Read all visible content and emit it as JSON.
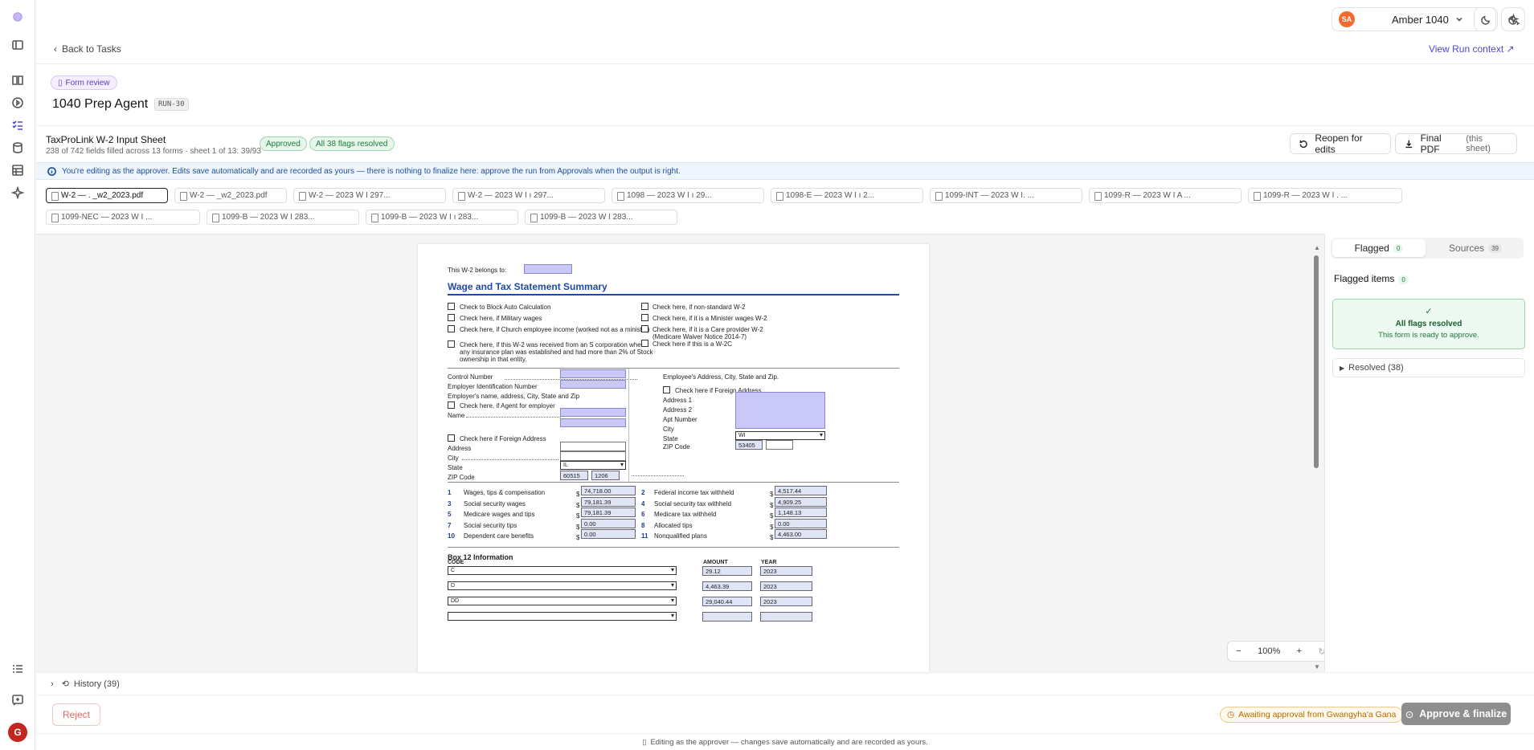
{
  "colors": {
    "accent": "#4b49c9",
    "approved": "#1c7a3c",
    "warning": "#b36b00",
    "reject": "#e06666",
    "avatar": "#f26a2e",
    "rail_user": "#c2261c"
  },
  "rail_icons": [
    "sidebar-toggle-icon",
    "book-icon",
    "play-icon",
    "tasks-icon",
    "database-icon",
    "table-icon",
    "sparkles-icon",
    "list-icon",
    "feedback-icon"
  ],
  "user": {
    "initials": "SA",
    "name": "Amber 1040",
    "rail_initial": "G"
  },
  "nav": {
    "back": "Back to Tasks",
    "run_context": "View Run context ↗"
  },
  "header": {
    "badge": "Form review",
    "title": "1040 Prep Agent",
    "run": "RUN-30"
  },
  "sheet": {
    "title": "TaxProLink W-2 Input Sheet",
    "subtitle": "238 of 742 fields filled across 13 forms · sheet 1 of 13: 39/93",
    "status": "Approved",
    "flags": "All 38 flags resolved",
    "reopen": "Reopen for edits",
    "final_pdf": "Final PDF",
    "final_pdf_note": "(this sheet)"
  },
  "info": "You're editing as the approver. Edits save automatically and are recorded as yours — there is nothing to finalize here: approve the run from Approvals when the output is right.",
  "tabs": [
    {
      "label": "W-2 — .        _w2_2023.pdf"
    },
    {
      "label": "W-2 —            _w2_2023.pdf"
    },
    {
      "label": "W-2 — 2023 W I                       297..."
    },
    {
      "label": "W-2 — 2023 W I                   ı 297..."
    },
    {
      "label": "1098 — 2023 W I                  ı 29..."
    },
    {
      "label": "1098-E — 2023 W I                  ı 2..."
    },
    {
      "label": "1099-INT — 2023 W I.                  ..."
    },
    {
      "label": "1099-R — 2023 W I A                  ..."
    },
    {
      "label": "1099-R — 2023 W I .                  ..."
    },
    {
      "label": "1099-NEC — 2023 W I                  ..."
    },
    {
      "label": "1099-B — 2023 W I                   283..."
    },
    {
      "label": "1099-B — 2023 W I              ı 283..."
    },
    {
      "label": "1099-B — 2023 W I                   283..."
    }
  ],
  "form": {
    "belongs": "This W-2 belongs to:",
    "heading": "Wage and Tax Statement Summary",
    "checks_left": [
      "Check to Block Auto Calculation",
      "Check here, if Military wages",
      "Check here, if Church employee income (worked not as a minister)",
      "Check here, if this W-2 was received from an S corporation where",
      "any insurance plan was established and had more than 2% of Stock",
      "ownership in that entity."
    ],
    "checks_right": [
      "Check here, if non-standard W-2",
      "Check here, if it is a Minister wages W-2",
      "Check here, if it is a Care provider W-2",
      "(Medicare Waiver Notice 2014-7)",
      "Check here if this is a W-2C"
    ],
    "employer": {
      "control": "Control Number",
      "ein": "Employer Identification Number",
      "name_addr": "Employer's name, address, City, State and Zip",
      "agent": "Check here, if Agent for employer",
      "name": "Name",
      "foreign": "Check here if Foreign Address",
      "address": "Address",
      "city": "City",
      "state": "State",
      "zip": "ZIP Code",
      "state_value": "IL",
      "zip1": "60515",
      "zip2": "1206"
    },
    "employee": {
      "heading": "Employee's Address, City, State and Zip.",
      "foreign": "Check here if Foreign Address",
      "address1": "Address 1",
      "address2": "Address 2",
      "apt": "Apt Number",
      "city": "City",
      "state": "State",
      "zip": "ZIP Code",
      "state_value": "WI",
      "zip1": "53405"
    },
    "boxes_left": [
      {
        "num": "1",
        "label": "Wages, tips & compensation",
        "value": "74,718.00"
      },
      {
        "num": "3",
        "label": "Social security wages",
        "value": "79,181.39"
      },
      {
        "num": "5",
        "label": "Medicare wages and tips",
        "value": "79,181.39"
      },
      {
        "num": "7",
        "label": "Social security tips",
        "value": "0.00"
      },
      {
        "num": "10",
        "label": "Dependent care benefits",
        "value": "0.00"
      }
    ],
    "boxes_right": [
      {
        "num": "2",
        "label": "Federal income tax withheld",
        "value": "4,517.44"
      },
      {
        "num": "4",
        "label": "Social security tax withheld",
        "value": "4,909.25"
      },
      {
        "num": "6",
        "label": "Medicare tax withheld",
        "value": "1,148.13"
      },
      {
        "num": "8",
        "label": "Allocated tips",
        "value": "0.00"
      },
      {
        "num": "11",
        "label": "Nonqualified plans",
        "value": "4,463.00"
      }
    ],
    "dollar": "$",
    "box12": {
      "heading": "Box 12 Information",
      "code": "CODE",
      "amount": "AMOUNT",
      "year": "YEAR",
      "rows": [
        {
          "code": "C",
          "amount": "29.12",
          "year": "2023"
        },
        {
          "code": "D",
          "amount": "4,463.39",
          "year": "2023"
        },
        {
          "code": "DD",
          "amount": "29,040.44",
          "year": "2023"
        }
      ]
    }
  },
  "zoom": {
    "value": "100%",
    "minus": "−",
    "plus": "+"
  },
  "panel": {
    "flagged": "Flagged",
    "flagged_count": "0",
    "sources": "Sources",
    "sources_count": "39",
    "items_heading": "Flagged items",
    "items_count": "0",
    "resolved_title": "All flags resolved",
    "resolved_sub": "This form is ready to approve.",
    "resolved_toggle": "Resolved (38)"
  },
  "history": "History (39)",
  "footer": {
    "reject": "Reject",
    "awaiting": "Awaiting approval from Gwangyha'a Gana",
    "approve": "Approve & finalize",
    "note": "Editing as the approver — changes save automatically and are recorded as yours."
  }
}
